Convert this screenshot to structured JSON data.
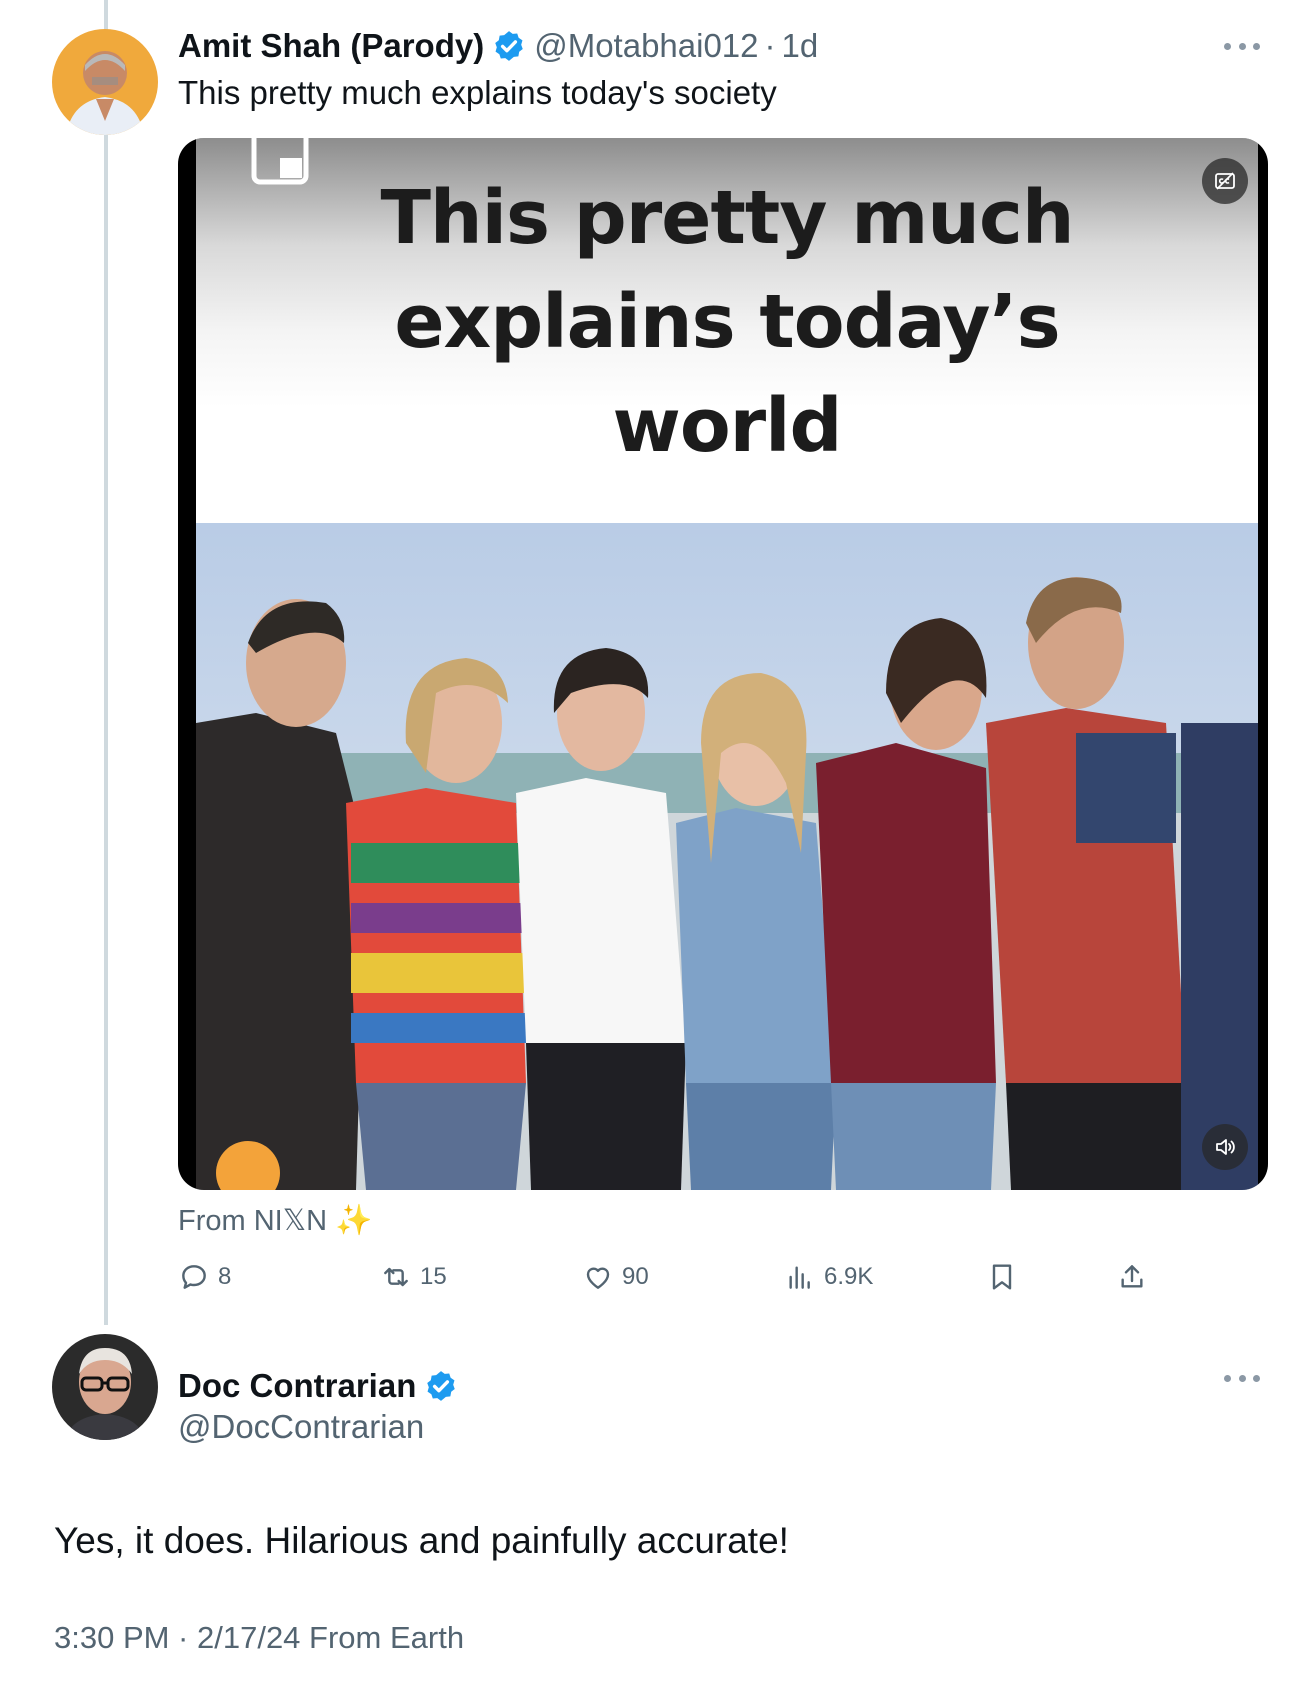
{
  "tweet": {
    "author_name": "Amit Shah (Parody)",
    "handle": "@Motabhai012",
    "separator": "·",
    "time": "1d",
    "text": "This pretty much explains today's society",
    "media": {
      "caption_lines": [
        "This pretty much",
        "explains today’s",
        "world"
      ],
      "cc_icon": "captions-icon",
      "sound_icon": "volume-icon"
    },
    "source": "From NI𝕏N",
    "source_emoji": "✨",
    "actions": {
      "replies": "8",
      "reposts": "15",
      "likes": "90",
      "views": "6.9K"
    }
  },
  "reply": {
    "author_name": "Doc Contrarian",
    "handle": "@DocContrarian",
    "text": "Yes, it does. Hilarious and painfully accurate!",
    "meta": "3:30 PM · 2/17/24 From Earth"
  },
  "colors": {
    "verified": "#1d9bf0",
    "secondary_text": "#536471",
    "thread_line": "#cfd9de"
  }
}
